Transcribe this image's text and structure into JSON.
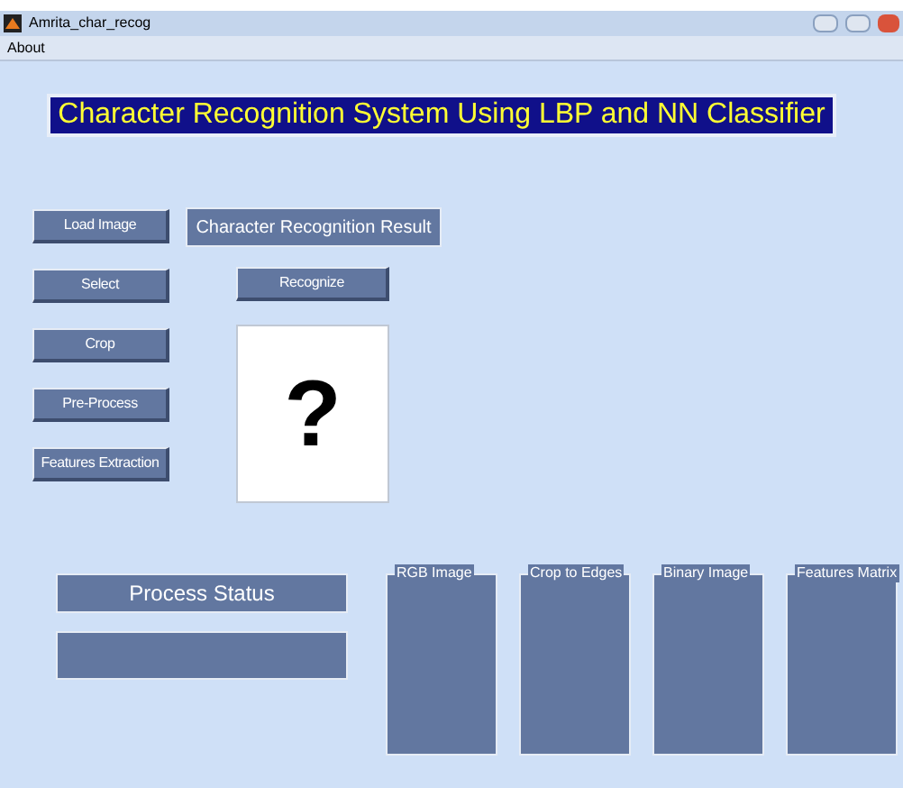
{
  "window": {
    "title": "Amrita_char_recog"
  },
  "menu": [
    "About"
  ],
  "banner": "Character Recognition System Using LBP and NN Classifier",
  "buttons": [
    "Load Image",
    "Select",
    "Crop",
    "Pre-Process",
    "Features Extraction"
  ],
  "result": {
    "label": "Character Recognition Result",
    "button": "Recognize",
    "output": "?"
  },
  "status": {
    "label": "Process Status"
  },
  "panels": [
    "RGB Image",
    "Crop to Edges",
    "Binary Image",
    "Features Matrix"
  ]
}
